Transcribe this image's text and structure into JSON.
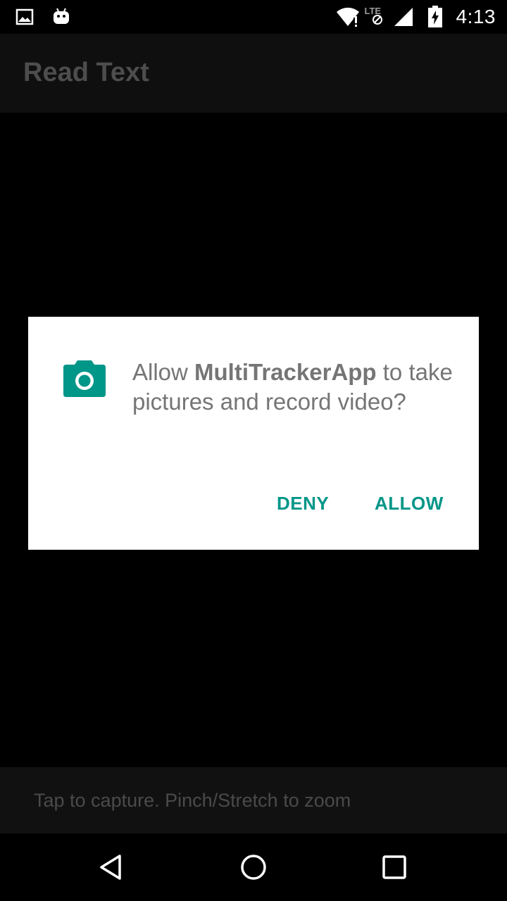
{
  "status_bar": {
    "time": "4:13",
    "network_label": "LTE",
    "icons": [
      "image-notification-icon",
      "android-notification-icon",
      "wifi-icon",
      "lte-icon",
      "signal-icon",
      "battery-charging-icon"
    ]
  },
  "app_bar": {
    "title": "Read Text"
  },
  "dialog": {
    "icon": "camera-icon",
    "message_prefix": "Allow ",
    "app_name": "MultiTrackerApp",
    "message_suffix": " to take pictures and record video?",
    "deny_label": "DENY",
    "allow_label": "ALLOW",
    "accent_color": "#009688"
  },
  "hint_bar": {
    "text": "Tap to capture. Pinch/Stretch to zoom"
  },
  "nav_bar": {
    "icons": [
      "back-icon",
      "home-icon",
      "recents-icon"
    ]
  }
}
